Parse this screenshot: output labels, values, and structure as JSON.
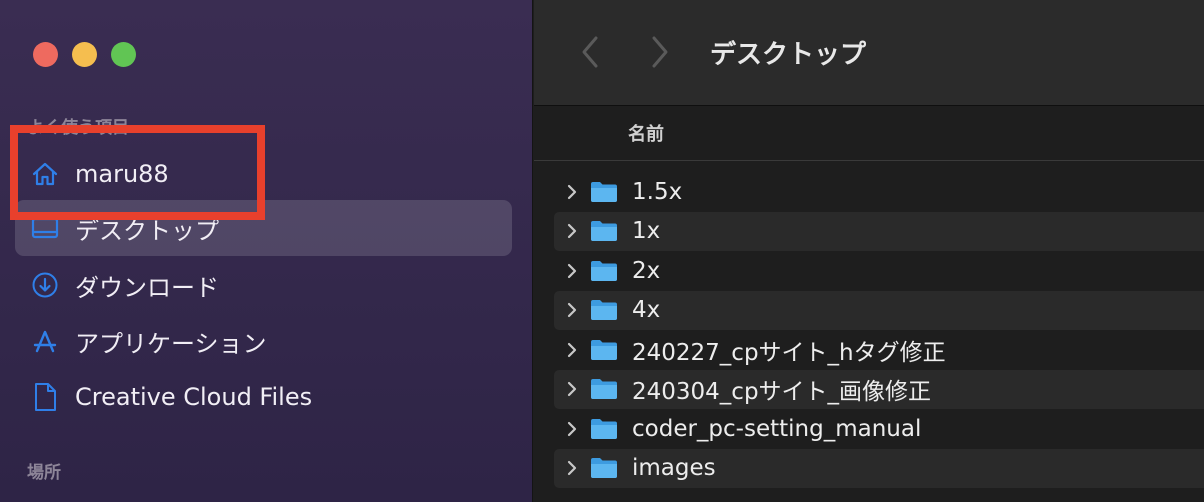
{
  "sidebar": {
    "favorites_label": "よく使う項目",
    "places_label": "場所",
    "items": [
      {
        "label": "maru88",
        "icon": "home-icon"
      },
      {
        "label": "デスクトップ",
        "icon": "desktop-icon"
      },
      {
        "label": "ダウンロード",
        "icon": "download-icon"
      },
      {
        "label": "アプリケーション",
        "icon": "applications-icon"
      },
      {
        "label": "Creative Cloud Files",
        "icon": "document-icon"
      }
    ]
  },
  "toolbar": {
    "title": "デスクトップ"
  },
  "list": {
    "column_name": "名前",
    "rows": [
      {
        "name": "1.5x"
      },
      {
        "name": "1x"
      },
      {
        "name": "2x"
      },
      {
        "name": "4x"
      },
      {
        "name": "240227_cpサイト_hタグ修正"
      },
      {
        "name": "240304_cpサイト_画像修正"
      },
      {
        "name": "coder_pc-setting_manual"
      },
      {
        "name": "images"
      }
    ]
  },
  "colors": {
    "accent": "#2f7fe8",
    "highlight": "#e8402c",
    "folder": "#4aa8e8"
  }
}
